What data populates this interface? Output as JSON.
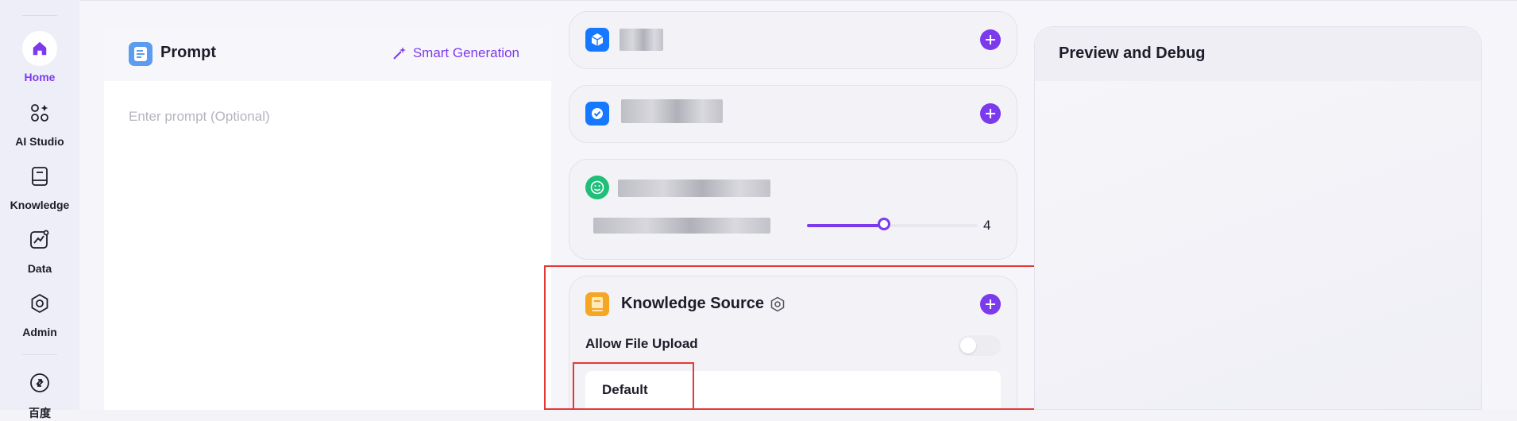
{
  "sidebar": {
    "items": [
      {
        "label": "Home",
        "icon": "home-icon",
        "active": true
      },
      {
        "label": "AI Studio",
        "icon": "ai-studio-icon",
        "active": false
      },
      {
        "label": "Knowledge",
        "icon": "book-icon",
        "active": false
      },
      {
        "label": "Data",
        "icon": "chart-icon",
        "active": false
      },
      {
        "label": "Admin",
        "icon": "gear-icon",
        "active": false
      },
      {
        "label": "百度",
        "icon": "swap-circle-icon",
        "active": false
      }
    ]
  },
  "prompt": {
    "title": "Prompt",
    "smart_generation": "Smart Generation",
    "placeholder": "Enter prompt (Optional)"
  },
  "cards": {
    "slider_value": 0.45,
    "slider_value_label": "4"
  },
  "knowledge_source": {
    "title": "Knowledge Source",
    "allow_file_upload": "Allow File Upload",
    "allow_file_upload_on": false,
    "default_label": "Default"
  },
  "preview": {
    "title": "Preview and Debug"
  },
  "colors": {
    "accent": "#7c3aed",
    "highlight": "#e53935",
    "blue": "#1677ff",
    "green": "#1fbf7a",
    "amber": "#f5a623"
  }
}
